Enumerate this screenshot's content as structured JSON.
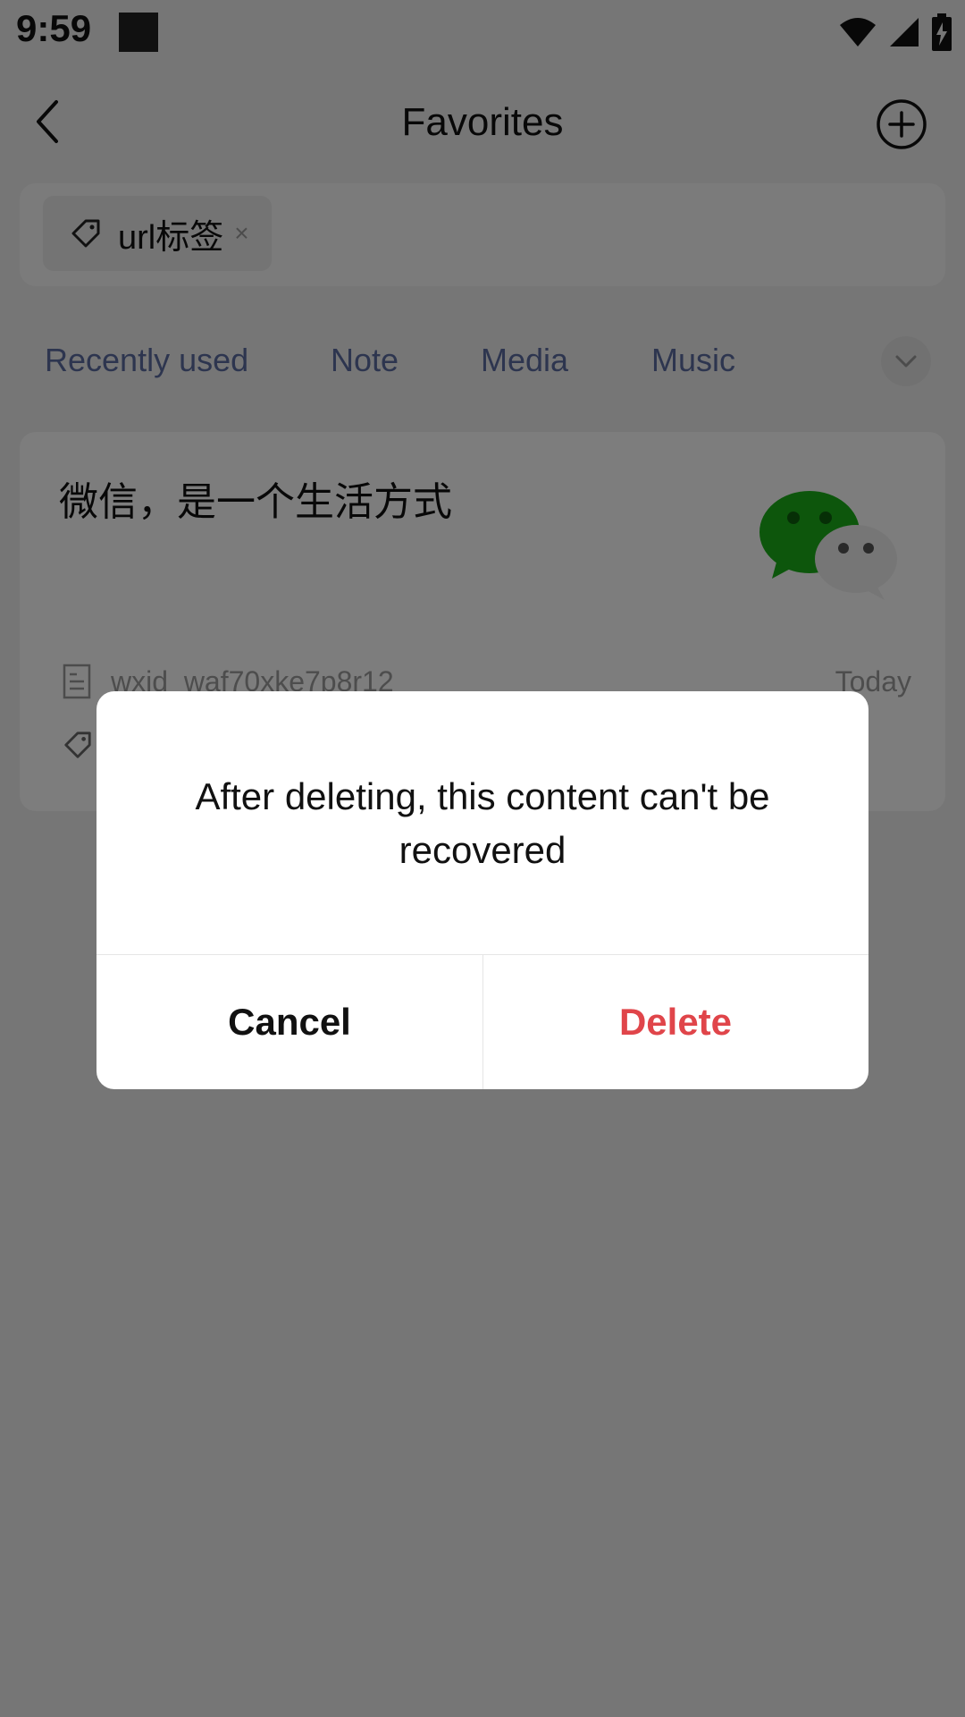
{
  "status_bar": {
    "time": "9:59",
    "icons": [
      "notification-square-icon",
      "wifi-icon",
      "signal-icon",
      "battery-charging-icon"
    ]
  },
  "app_bar": {
    "title": "Favorites",
    "back_icon": "back-arrow-icon",
    "add_icon": "add-circle-icon"
  },
  "tag_filter": {
    "chip_label": "url标签",
    "chip_close": "×",
    "chip_icon": "tag-icon"
  },
  "tabs": {
    "items": [
      {
        "label": "Recently used"
      },
      {
        "label": "Note"
      },
      {
        "label": "Media"
      },
      {
        "label": "Music"
      }
    ],
    "expand_icon": "chevron-down-icon"
  },
  "favorite_item": {
    "title": "微信，是一个生活方式",
    "source": "wxid_waf70xke7p8r12",
    "time": "Today",
    "thumbnail_icon": "wechat-logo-icon"
  },
  "dialog": {
    "message": "After deleting, this content can't be recovered",
    "cancel_label": "Cancel",
    "delete_label": "Delete"
  },
  "colors": {
    "accent_delete": "#e0454a",
    "tab_text": "#5a6b9e",
    "wechat_green": "#1aad19"
  }
}
